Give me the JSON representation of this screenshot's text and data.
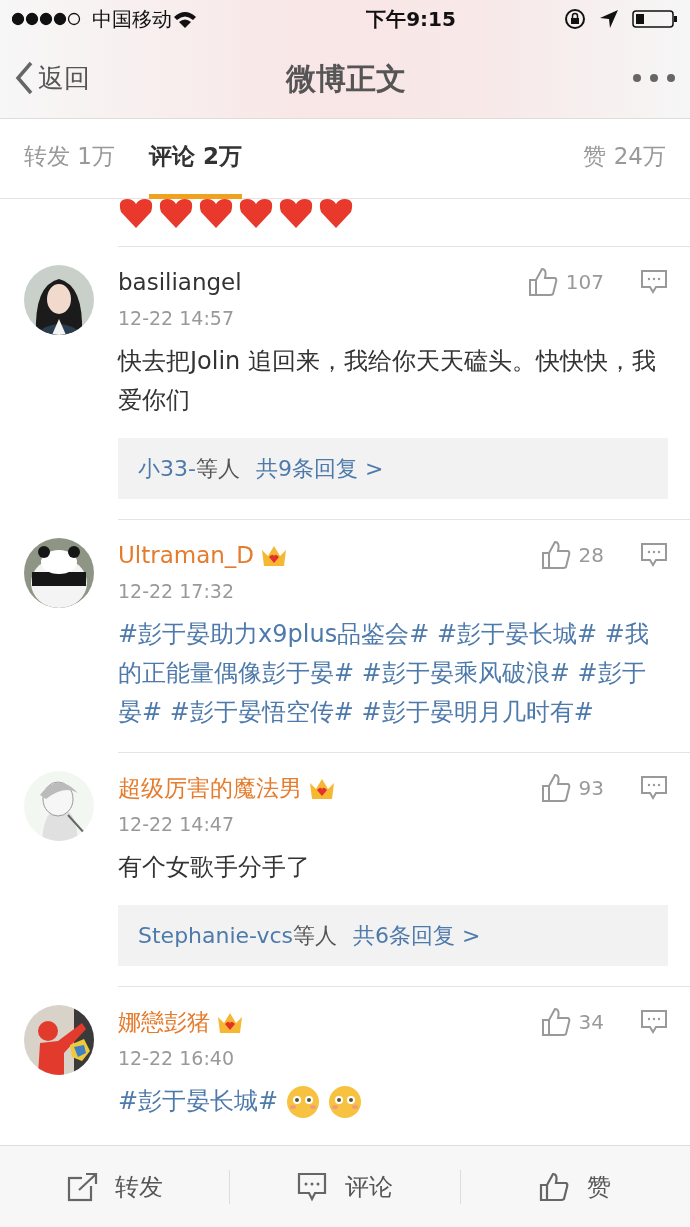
{
  "status_bar": {
    "carrier": "中国移动",
    "time": "下午9:15"
  },
  "nav": {
    "back": "返回",
    "title": "微博正文"
  },
  "tabs": [
    {
      "label": "转发 1万",
      "selected": false
    },
    {
      "label": "评论 2万",
      "selected": true
    },
    {
      "label": "赞 24万",
      "selected": false
    }
  ],
  "comments": [
    {
      "user": "basiliangel",
      "vip": false,
      "time": "12-22 14:57",
      "likes": "107",
      "parts": [
        {
          "kind": "text",
          "text": "快去把Jolin 追回来，我给你天天磕头。快快快，我爱你们"
        }
      ],
      "replies": {
        "names": "小33-",
        "suffix": "等人",
        "count": "共9条回复 >"
      }
    },
    {
      "user": "Ultraman_D",
      "vip": true,
      "time": "12-22 17:32",
      "likes": "28",
      "parts": [
        {
          "kind": "topic",
          "text": "#彭于晏助力x9plus品鉴会# #彭于晏长城# #我的正能量偶像彭于晏# #彭于晏乘风破浪# #彭于晏# #彭于晏悟空传# #彭于晏明月几时有#"
        }
      ]
    },
    {
      "user": "超级厉害的魔法男",
      "vip": true,
      "time": "12-22 14:47",
      "likes": "93",
      "parts": [
        {
          "kind": "text",
          "text": "有个女歌手分手了"
        }
      ],
      "replies": {
        "names": "Stephanie-vcs",
        "suffix": "等人",
        "count": "共6条回复 >"
      }
    },
    {
      "user": "娜戀彭猪",
      "vip": true,
      "time": "12-22 16:40",
      "likes": "34",
      "parts": [
        {
          "kind": "topic",
          "text": "#彭于晏长城#"
        },
        {
          "kind": "emoji"
        },
        {
          "kind": "emoji"
        }
      ]
    }
  ],
  "toolbar": [
    {
      "kind": "share",
      "label": "转发"
    },
    {
      "kind": "comment",
      "label": "评论"
    },
    {
      "kind": "like",
      "label": "赞"
    }
  ]
}
